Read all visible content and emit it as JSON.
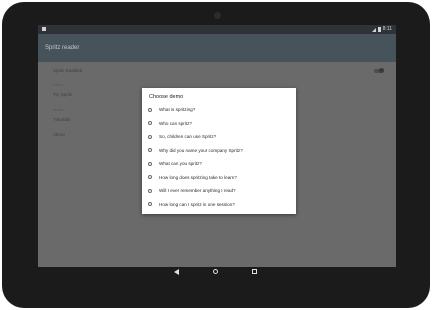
{
  "status_bar": {
    "time": "8:11"
  },
  "app": {
    "title": "Spritz reader"
  },
  "settings": {
    "enabled_label": "Spritz Enabled",
    "sections": [
      {
        "header": "Demo",
        "items": [
          "Try Spritz"
        ]
      },
      {
        "header": "About",
        "items": [
          "Tutorials",
          "About"
        ]
      }
    ]
  },
  "dialog": {
    "title": "Choose demo",
    "options": [
      "What is spritzing?",
      "Who can spritz?",
      "So, children can use Spritz?",
      "Why did you name your company Spritz?",
      "What can you spritz?",
      "How long does spritzing take to learn?",
      "Will I ever remember anything I read?",
      "How long can I spritz in one session?"
    ]
  },
  "navigation": {
    "back": "back-icon",
    "home": "home-icon",
    "recents": "recents-icon"
  }
}
